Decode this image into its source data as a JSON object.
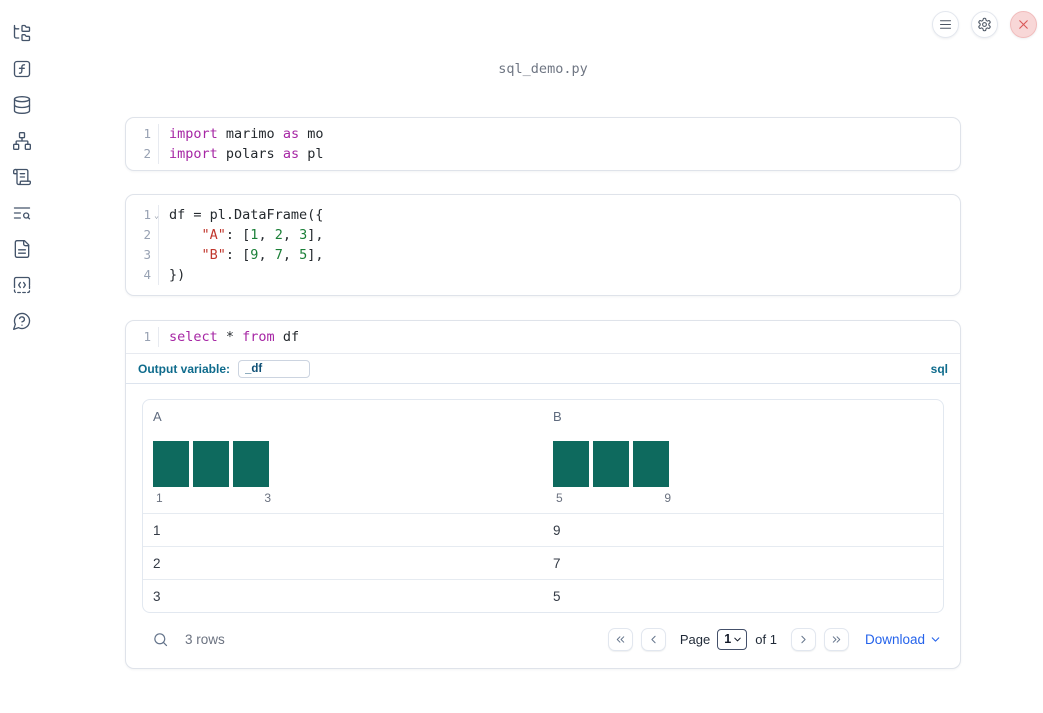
{
  "app": {
    "filename": "sql_demo.py"
  },
  "topbar": {
    "buttons": [
      {
        "icon": "hamburger-menu-icon"
      },
      {
        "icon": "gear-icon"
      },
      {
        "icon": "close-icon"
      }
    ]
  },
  "sidebar": {
    "items": [
      {
        "icon": "file-tree-icon"
      },
      {
        "icon": "function-square-icon"
      },
      {
        "icon": "database-icon"
      },
      {
        "icon": "dependency-graph-icon"
      },
      {
        "icon": "scroll-logs-icon"
      },
      {
        "icon": "text-search-icon"
      },
      {
        "icon": "document-icon"
      },
      {
        "icon": "code-snippets-icon"
      },
      {
        "icon": "help-chat-icon"
      }
    ]
  },
  "cells": [
    {
      "lines": [
        {
          "n": "1",
          "tokens": [
            {
              "c": "kw",
              "t": "import"
            },
            {
              "c": "pl",
              "t": " marimo "
            },
            {
              "c": "kw",
              "t": "as"
            },
            {
              "c": "pl",
              "t": " mo"
            }
          ]
        },
        {
          "n": "2",
          "tokens": [
            {
              "c": "kw",
              "t": "import"
            },
            {
              "c": "pl",
              "t": " polars "
            },
            {
              "c": "kw",
              "t": "as"
            },
            {
              "c": "pl",
              "t": " pl"
            }
          ]
        }
      ]
    },
    {
      "lines": [
        {
          "n": "1",
          "fold": "v",
          "tokens": [
            {
              "c": "pl",
              "t": "df = pl.DataFrame({"
            }
          ]
        },
        {
          "n": "2",
          "tokens": [
            {
              "c": "pl",
              "t": "    "
            },
            {
              "c": "str",
              "t": "\"A\""
            },
            {
              "c": "pl",
              "t": ": ["
            },
            {
              "c": "num",
              "t": "1"
            },
            {
              "c": "pl",
              "t": ", "
            },
            {
              "c": "num",
              "t": "2"
            },
            {
              "c": "pl",
              "t": ", "
            },
            {
              "c": "num",
              "t": "3"
            },
            {
              "c": "pl",
              "t": "],"
            }
          ]
        },
        {
          "n": "3",
          "tokens": [
            {
              "c": "pl",
              "t": "    "
            },
            {
              "c": "str",
              "t": "\"B\""
            },
            {
              "c": "pl",
              "t": ": ["
            },
            {
              "c": "num",
              "t": "9"
            },
            {
              "c": "pl",
              "t": ", "
            },
            {
              "c": "num",
              "t": "7"
            },
            {
              "c": "pl",
              "t": ", "
            },
            {
              "c": "num",
              "t": "5"
            },
            {
              "c": "pl",
              "t": "],"
            }
          ]
        },
        {
          "n": "4",
          "tokens": [
            {
              "c": "pl",
              "t": "})"
            }
          ]
        }
      ]
    },
    {
      "lines": [
        {
          "n": "1",
          "tokens": [
            {
              "c": "kw",
              "t": "select"
            },
            {
              "c": "pl",
              "t": " * "
            },
            {
              "c": "kw",
              "t": "from"
            },
            {
              "c": "pl",
              "t": " df"
            }
          ]
        }
      ]
    }
  ],
  "sql_cell": {
    "output_variable_label": "Output variable:",
    "output_variable_value": "_df",
    "language_badge": "sql"
  },
  "table": {
    "columns": [
      {
        "name": "A",
        "histogram": {
          "bars": [
            1,
            1,
            1
          ],
          "min_label": "1",
          "max_label": "3"
        }
      },
      {
        "name": "B",
        "histogram": {
          "bars": [
            1,
            1,
            1
          ],
          "min_label": "5",
          "max_label": "9"
        }
      }
    ],
    "rows": [
      [
        "1",
        "9"
      ],
      [
        "2",
        "7"
      ],
      [
        "3",
        "5"
      ]
    ],
    "footer": {
      "row_count": "3 rows",
      "page_label": "Page",
      "page_value": "1",
      "of_label": "of 1",
      "download_label": "Download"
    }
  },
  "colors": {
    "histogram_bar": "#0e6a5e",
    "accent_blue": "#0e6b8c",
    "link_blue": "#2563eb",
    "keyword": "#a626a4",
    "string": "#c0362c",
    "number": "#1a7f37"
  }
}
